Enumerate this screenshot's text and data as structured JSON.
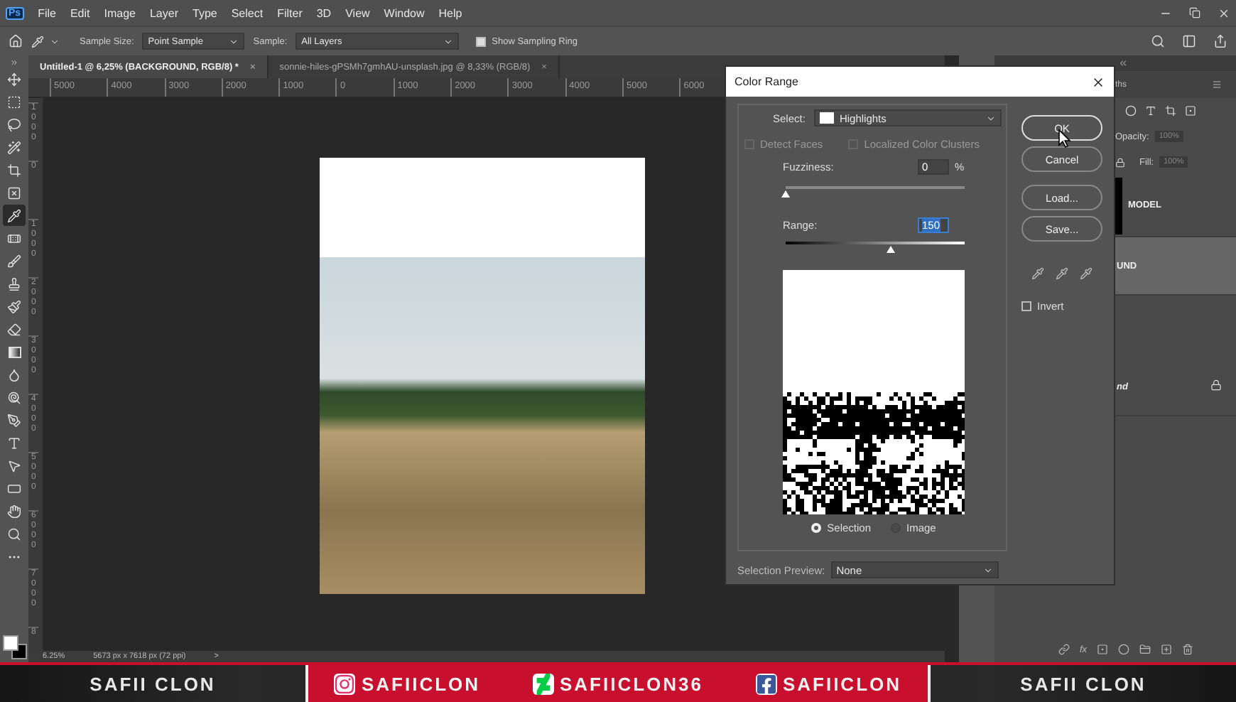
{
  "menu_bar": {
    "logo": "Ps",
    "items": [
      "File",
      "Edit",
      "Image",
      "Layer",
      "Type",
      "Select",
      "Filter",
      "3D",
      "View",
      "Window",
      "Help"
    ]
  },
  "options_bar": {
    "sample_size_label": "Sample Size:",
    "sample_size": "Point Sample",
    "sample_label": "Sample:",
    "sample": "All Layers",
    "sampling_ring": {
      "label": "Show Sampling Ring",
      "checked": true
    }
  },
  "tools": [
    {
      "kind": "move",
      "selected": false
    },
    {
      "kind": "marquee",
      "selected": false
    },
    {
      "kind": "lasso",
      "selected": false
    },
    {
      "kind": "wand",
      "selected": false
    },
    {
      "kind": "crop",
      "selected": false
    },
    {
      "kind": "frame",
      "selected": false
    },
    {
      "kind": "eyedropper",
      "selected": true
    },
    {
      "kind": "healing",
      "selected": false
    },
    {
      "kind": "brush",
      "selected": false
    },
    {
      "kind": "stamp",
      "selected": false
    },
    {
      "kind": "history",
      "selected": false
    },
    {
      "kind": "eraser",
      "selected": false
    },
    {
      "kind": "gradient",
      "selected": false
    },
    {
      "kind": "blur",
      "selected": false
    },
    {
      "kind": "dodge",
      "selected": false
    },
    {
      "kind": "pen",
      "selected": false
    },
    {
      "kind": "type",
      "selected": false
    },
    {
      "kind": "path",
      "selected": false
    },
    {
      "kind": "shape",
      "selected": false
    },
    {
      "kind": "hand",
      "selected": false
    },
    {
      "kind": "zoom",
      "selected": false
    },
    {
      "kind": "more",
      "selected": false
    }
  ],
  "tabs": [
    {
      "label": "Untitled-1 @ 6,25% (BACKGROUND, RGB/8) *",
      "close": "×",
      "selected": true
    },
    {
      "label": "sonnie-hiles-gPSMh7gmhAU-unsplash.jpg @ 8,33% (RGB/8)",
      "close": "×",
      "selected": false
    }
  ],
  "rulers": {
    "horizontal": [
      "5000",
      "4000",
      "3000",
      "2000",
      "1000",
      "0",
      "1000",
      "2000",
      "3000",
      "4000",
      "5000",
      "6000"
    ],
    "vertical": [
      "1000",
      "0",
      "1000",
      "2000",
      "3000",
      "4000",
      "5000",
      "6000",
      "7000",
      "8"
    ]
  },
  "status_bar": {
    "zoom": "6.25%",
    "doc_size": "5673 px x 7618 px (72 ppi)",
    "arrow": ">"
  },
  "layers_panel": {
    "tab": "ths",
    "fx": "fx",
    "opacity_label": "Opacity:",
    "opacity": "100%",
    "fill_label": "Fill:",
    "fill": "100%",
    "layers": [
      {
        "name": "MODEL",
        "selected": false,
        "locked": false,
        "italic": false
      },
      {
        "name": "UND",
        "selected": true,
        "locked": false,
        "italic": false
      },
      {
        "name": "nd",
        "selected": false,
        "locked": true,
        "italic": true
      }
    ]
  },
  "dialog": {
    "title": "Color Range",
    "select_label": "Select:",
    "select_value": "Highlights",
    "options": [
      {
        "label": "Detect Faces",
        "checked": false,
        "disabled": true
      },
      {
        "label": "Localized Color Clusters",
        "checked": false,
        "disabled": true
      }
    ],
    "fuzziness": {
      "label": "Fuzziness:",
      "value": "0",
      "unit": "%",
      "level": 0,
      "highlighted": false
    },
    "range": {
      "label": "Range:",
      "value": "150",
      "level": 0.59,
      "highlighted": true
    },
    "view": [
      {
        "label": "Selection",
        "selected": true
      },
      {
        "label": "Image",
        "selected": false
      }
    ],
    "preview_label": "Selection Preview:",
    "preview_value": "None",
    "buttons": [
      {
        "label": "OK",
        "focused": true
      },
      {
        "label": "Cancel",
        "focused": false
      },
      {
        "label": "Load...",
        "focused": false
      },
      {
        "label": "Save...",
        "focused": false
      }
    ],
    "invert": {
      "label": "Invert",
      "checked": false
    }
  },
  "banner": {
    "left": "SAFII CLON",
    "socials": [
      {
        "kind": "instagram",
        "handle": "SAFIICLON"
      },
      {
        "kind": "zigzag",
        "handle": "SAFIICLON36"
      },
      {
        "kind": "facebook",
        "handle": "SAFIICLON"
      }
    ],
    "right": "SAFII CLON"
  }
}
